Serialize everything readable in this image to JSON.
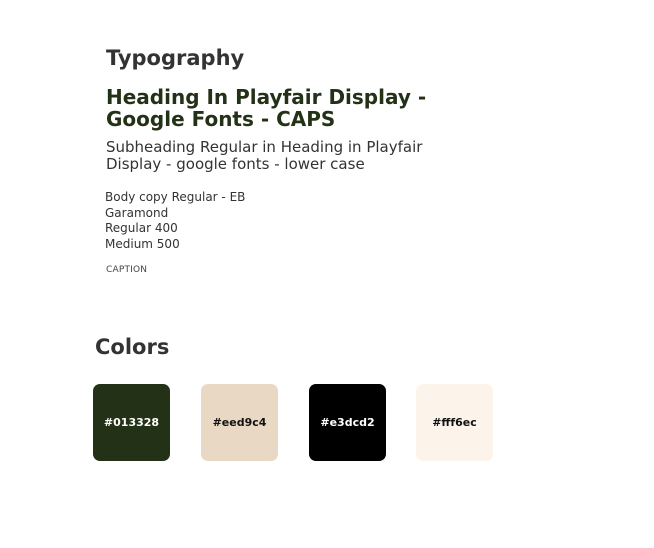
{
  "typography": {
    "title": "Typography",
    "heading": "Heading In Playfair Display - Google Fonts - CAPS",
    "subheading": "Subheading Regular in Heading in Playfair Display - google fonts - lower case",
    "body_lines": [
      "Body copy Regular - EB",
      "Garamond",
      "Regular 400",
      "Medium 500"
    ],
    "caption": "CAPTION"
  },
  "colors": {
    "title": "Colors",
    "swatches": [
      {
        "label": "#013328",
        "fill": "#233217",
        "text_color": "#ffffff"
      },
      {
        "label": "#eed9c4",
        "fill": "#e9d8c3",
        "text_color": "#111111"
      },
      {
        "label": "#e3dcd2",
        "fill": "#000000",
        "text_color": "#ffffff"
      },
      {
        "label": "#fff6ec",
        "fill": "#fcf4ea",
        "text_color": "#111111"
      }
    ]
  }
}
